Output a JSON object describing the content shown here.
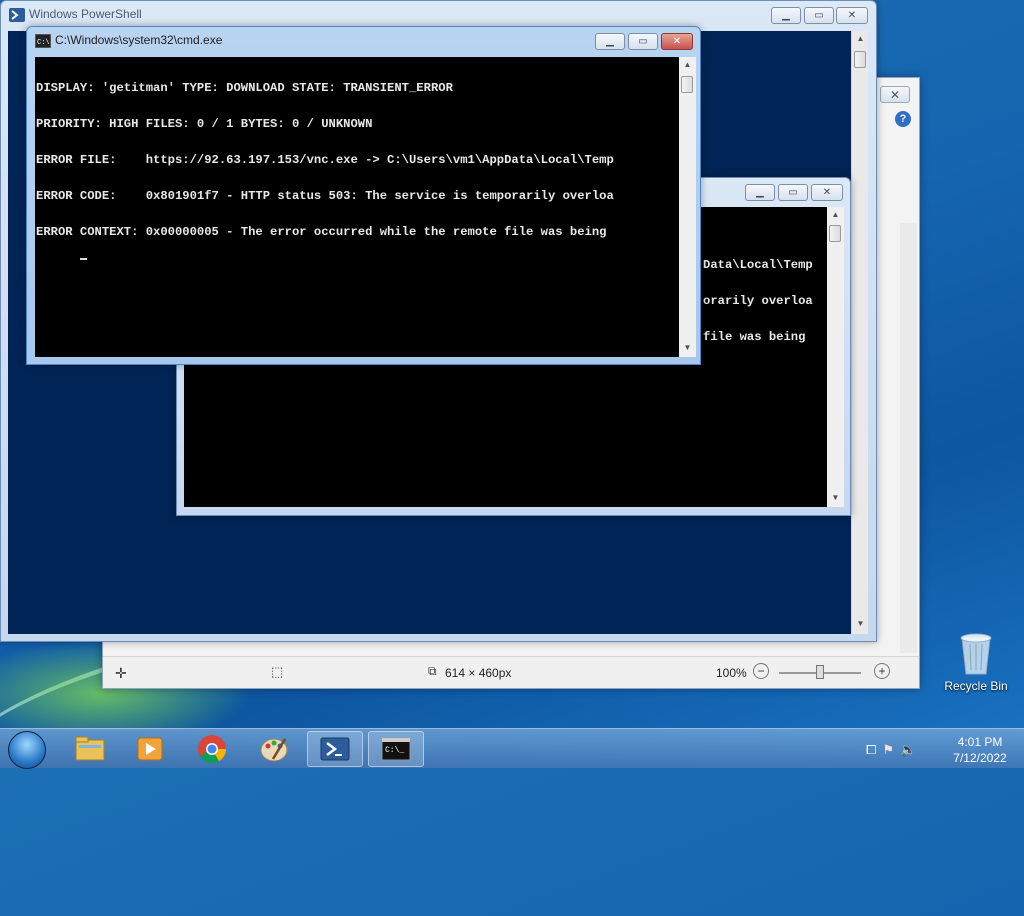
{
  "powershell": {
    "title": "Windows PowerShell"
  },
  "paint": {
    "dimensions": "614 × 460px",
    "zoom": "100%",
    "close_glyph": "✕",
    "help_glyph": "?"
  },
  "cmd_back": {
    "lines": [
      "Data\\Local\\Temp",
      "orarily overloa",
      "file was being"
    ]
  },
  "cmd_front": {
    "title": "C:\\Windows\\system32\\cmd.exe",
    "lines": [
      "DISPLAY: 'getitman' TYPE: DOWNLOAD STATE: TRANSIENT_ERROR",
      "PRIORITY: HIGH FILES: 0 / 1 BYTES: 0 / UNKNOWN",
      "ERROR FILE:    https://92.63.197.153/vnc.exe -> C:\\Users\\vm1\\AppData\\Local\\Temp",
      "ERROR CODE:    0x801901f7 - HTTP status 503: The service is temporarily overloa",
      "ERROR CONTEXT: 0x00000005 - The error occurred while the remote file was being"
    ]
  },
  "desktop": {
    "recycle_bin": "Recycle Bin"
  },
  "taskbar": {
    "time": "4:01 PM",
    "date": "7/12/2022",
    "apps": [
      "start-orb",
      "explorer",
      "media-player",
      "chrome",
      "paint",
      "powershell",
      "cmd"
    ]
  }
}
